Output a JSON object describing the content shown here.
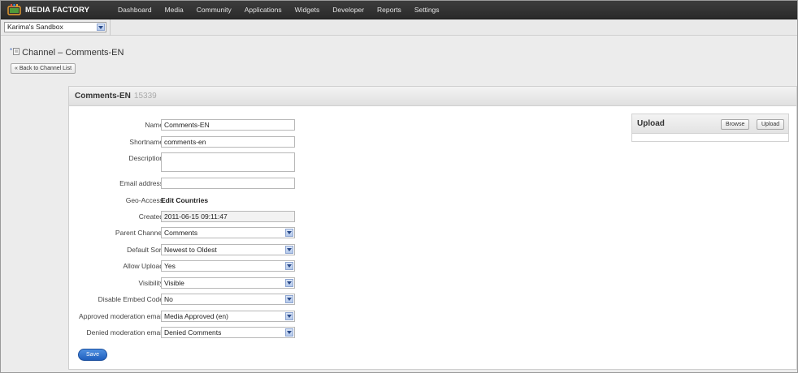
{
  "app": {
    "name": "MEDIA FACTORY"
  },
  "nav": [
    {
      "label": "Dashboard"
    },
    {
      "label": "Media"
    },
    {
      "label": "Community"
    },
    {
      "label": "Applications"
    },
    {
      "label": "Widgets"
    },
    {
      "label": "Developer"
    },
    {
      "label": "Reports"
    },
    {
      "label": "Settings"
    }
  ],
  "sandbox": {
    "selected": "Karima's Sandbox"
  },
  "page": {
    "title": "Channel – Comments-EN",
    "back_label": "« Back to Channel List"
  },
  "panel": {
    "title": "Comments-EN",
    "id": "15339"
  },
  "form": {
    "name": {
      "label": "Name",
      "value": "Comments-EN"
    },
    "shortname": {
      "label": "Shortname",
      "value": "comments-en"
    },
    "description": {
      "label": "Description",
      "value": ""
    },
    "email": {
      "label": "Email address",
      "value": ""
    },
    "geo": {
      "label": "Geo-Access",
      "link": "Edit Countries"
    },
    "created": {
      "label": "Created",
      "value": "2011-06-15 09:11:47"
    },
    "parent_channel": {
      "label": "Parent Channel",
      "value": "Comments"
    },
    "default_sort": {
      "label": "Default Sort",
      "value": "Newest to Oldest"
    },
    "allow_upload": {
      "label": "Allow Upload",
      "value": "Yes"
    },
    "visibility": {
      "label": "Visibility",
      "value": "Visible"
    },
    "disable_embed": {
      "label": "Disable Embed Code",
      "value": "No"
    },
    "approved_email": {
      "label": "Approved moderation email",
      "value": "Media Approved (en)"
    },
    "denied_email": {
      "label": "Denied moderation email",
      "value": "Denied Comments"
    },
    "save_label": "Save"
  },
  "upload": {
    "title": "Upload",
    "browse_label": "Browse",
    "upload_label": "Upload"
  }
}
